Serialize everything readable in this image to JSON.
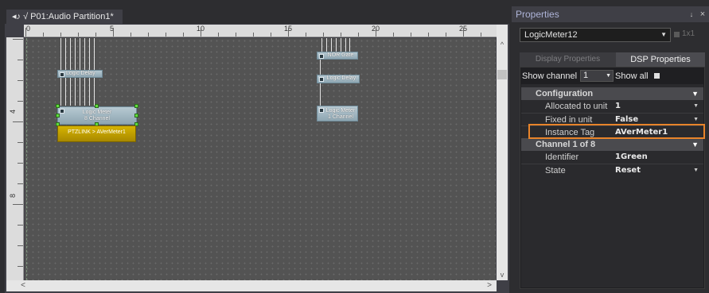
{
  "document": {
    "tab_label": "◂♪ √ P01:Audio Partition1*",
    "ruler_top_labels": [
      "0",
      "5",
      "10",
      "15",
      "20",
      "25"
    ],
    "ruler_left_labels": [
      "4",
      "8"
    ]
  },
  "canvas": {
    "blocks": {
      "logic_delay_a": "Logic Delay",
      "logic_meter_8": {
        "line1": "Logic Meter",
        "line2": "8 Channel"
      },
      "ptzlink": "PTZLINK > AVerMeter1",
      "nor_gate": "NOR Gate",
      "logic_delay_b": "Logic Delay",
      "logic_meter_1": {
        "line1": "Logic Meter",
        "line2": "1 Channel"
      }
    }
  },
  "scroll": {
    "left_arrow": "<",
    "right_arrow": ">",
    "up_arrow": "^",
    "down_arrow": "v"
  },
  "properties": {
    "title": "Properties",
    "pin_icon": "↓",
    "close_icon": "×",
    "object_select": "LogicMeter12",
    "size_label": "1x1",
    "tabs": {
      "display": "Display Properties",
      "dsp": "DSP Properties"
    },
    "show_channel_label": "Show channel",
    "show_channel_value": "1",
    "show_all_label": "Show all",
    "rows": {
      "configuration": "Configuration",
      "allocated_name": "Allocated to unit",
      "allocated_value": "1",
      "fixed_name": "Fixed in unit",
      "fixed_value": "False",
      "instance_name": "Instance Tag",
      "instance_value": "AVerMeter1",
      "channel_cat": "Channel  1  of  8",
      "identifier_name": "Identifier",
      "identifier_value": "1Green",
      "state_name": "State",
      "state_value": "Reset"
    }
  },
  "colors": {
    "highlight": "#e8842a",
    "handle": "#5fdc3c",
    "ptzlink": "#c8a800"
  }
}
